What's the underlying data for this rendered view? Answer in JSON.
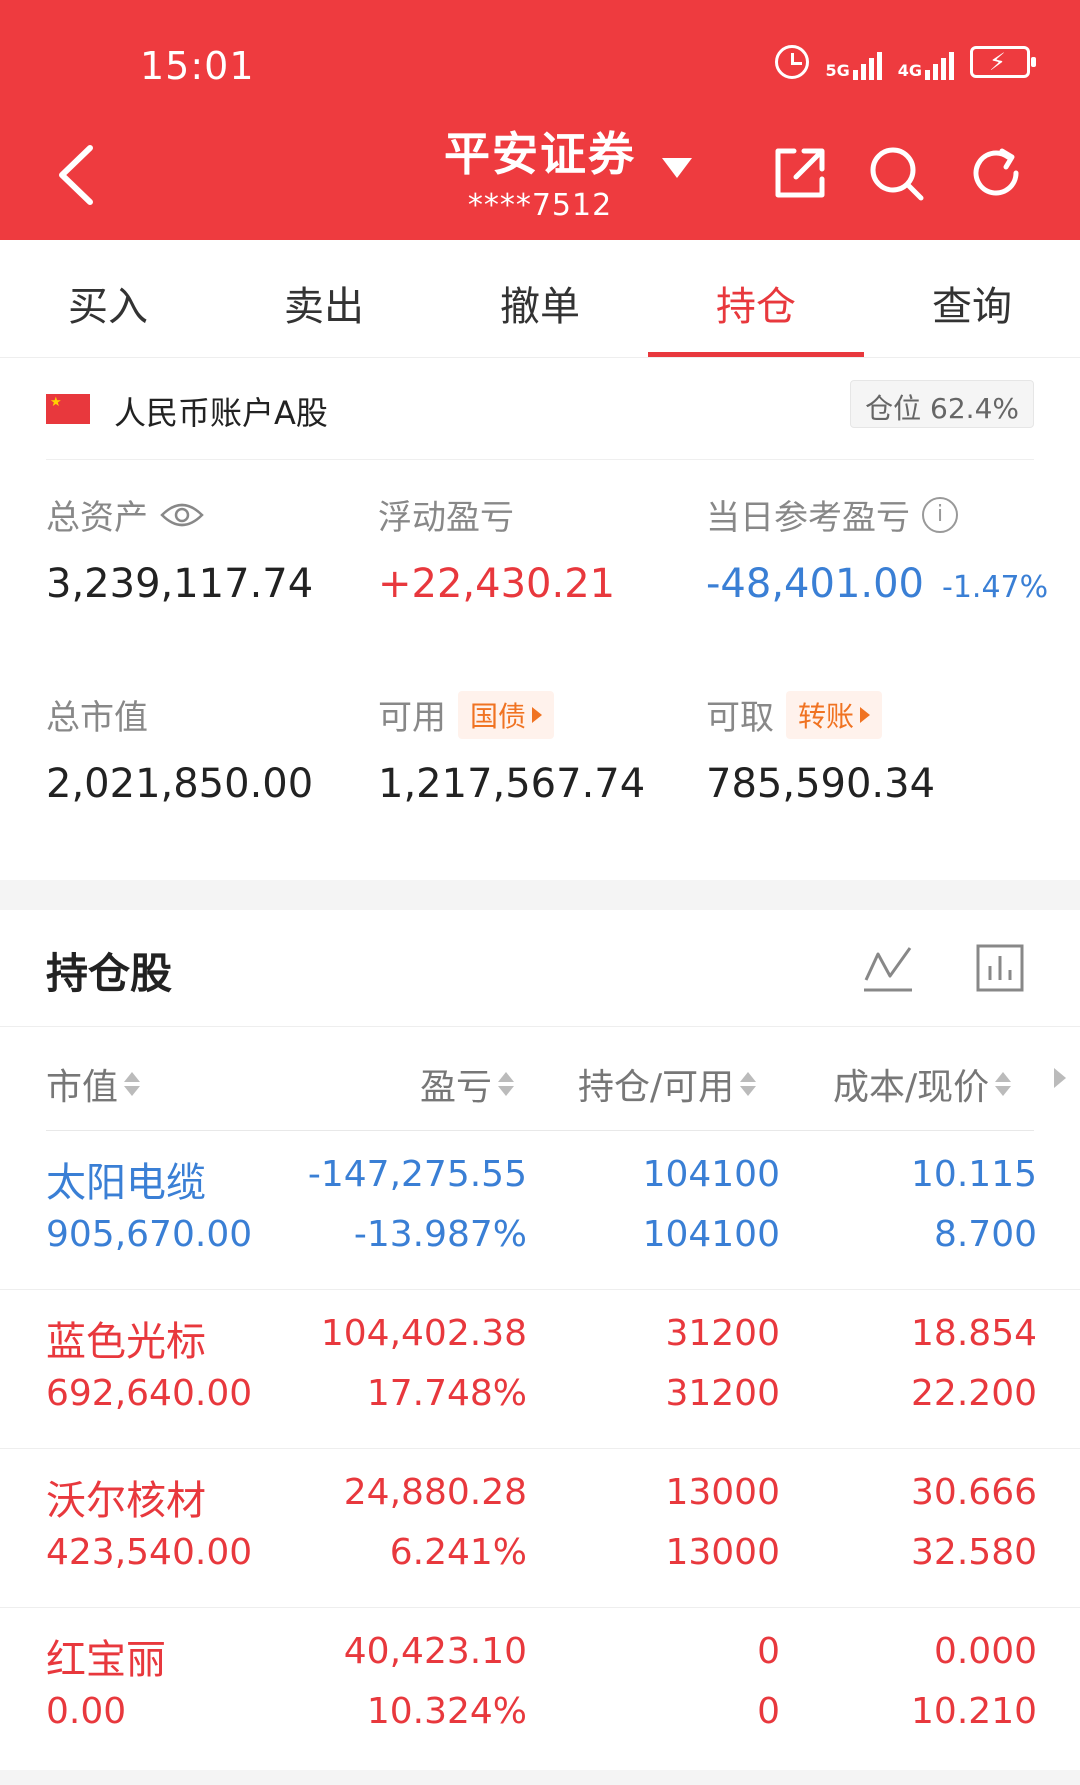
{
  "status": {
    "time": "15:01",
    "net1": "5G",
    "net2": "4G"
  },
  "header": {
    "title": "平安证券",
    "account_masked": "****7512"
  },
  "tabs": [
    {
      "label": "买入"
    },
    {
      "label": "卖出"
    },
    {
      "label": "撤单"
    },
    {
      "label": "持仓"
    },
    {
      "label": "查询"
    }
  ],
  "account": {
    "name": "人民币账户A股",
    "position_label": "仓位",
    "position_value": "62.4%"
  },
  "summary": {
    "total_assets_label": "总资产",
    "total_assets_value": "3,239,117.74",
    "floating_pl_label": "浮动盈亏",
    "floating_pl_value": "+22,430.21",
    "today_pl_label": "当日参考盈亏",
    "today_pl_value": "-48,401.00",
    "today_pl_pct": "-1.47%",
    "market_value_label": "总市值",
    "market_value_value": "2,021,850.00",
    "available_label": "可用",
    "available_tag": "国债",
    "available_value": "1,217,567.74",
    "withdrawable_label": "可取",
    "withdrawable_tag": "转账",
    "withdrawable_value": "785,590.34"
  },
  "holdings": {
    "title": "持仓股",
    "columns": {
      "market_value": "市值",
      "pl": "盈亏",
      "position": "持仓/可用",
      "cost": "成本/现价"
    },
    "rows": [
      {
        "name": "太阳电缆",
        "market_value": "905,670.00",
        "pl": "-147,275.55",
        "pl_pct": "-13.987%",
        "position": "104100",
        "available": "104100",
        "cost": "10.115",
        "price": "8.700",
        "tone": "blue"
      },
      {
        "name": "蓝色光标",
        "market_value": "692,640.00",
        "pl": "104,402.38",
        "pl_pct": "17.748%",
        "position": "31200",
        "available": "31200",
        "cost": "18.854",
        "price": "22.200",
        "tone": "red"
      },
      {
        "name": "沃尔核材",
        "market_value": "423,540.00",
        "pl": "24,880.28",
        "pl_pct": "6.241%",
        "position": "13000",
        "available": "13000",
        "cost": "30.666",
        "price": "32.580",
        "tone": "red"
      },
      {
        "name": "红宝丽",
        "market_value": "0.00",
        "pl": "40,423.10",
        "pl_pct": "10.324%",
        "position": "0",
        "available": "0",
        "cost": "0.000",
        "price": "10.210",
        "tone": "red"
      }
    ]
  },
  "colors": {
    "brand_red": "#ee3b3f",
    "profit_red": "#e8383d",
    "loss_blue": "#3a7fd5",
    "tag_orange": "#f07322"
  }
}
